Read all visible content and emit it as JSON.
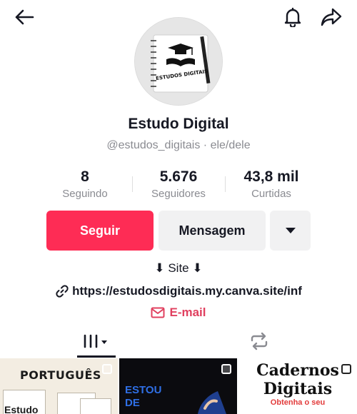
{
  "profile": {
    "display_name": "Estudo Digital",
    "handle": "@estudos_digitais · ele/dele",
    "avatar_text": "ESTUDOS DIGITAIS"
  },
  "stats": [
    {
      "value": "8",
      "label": "Seguindo"
    },
    {
      "value": "5.676",
      "label": "Seguidores"
    },
    {
      "value": "43,8 mil",
      "label": "Curtidas"
    }
  ],
  "actions": {
    "follow_label": "Seguir",
    "message_label": "Mensagem"
  },
  "bio": {
    "site_label": "⬇ Site ⬇",
    "link_text": "https://estudosdigitais.my.canva.site/inf",
    "email_label": "E-mail"
  },
  "grid": [
    {
      "title": "PORTUGUÊS",
      "subtitle": "Estudo"
    },
    {
      "title": "ESTOU DE"
    },
    {
      "title": "Cadernos Digitais",
      "subtitle": "Obtenha o seu"
    }
  ],
  "colors": {
    "accent": "#fe2c55",
    "email": "#e0405f",
    "text": "#161823",
    "muted": "#8a8b91"
  },
  "icons": {
    "back": "arrow-left-icon",
    "bell": "bell-icon",
    "share": "share-arrow-icon",
    "link": "link-icon",
    "mail": "mail-icon",
    "videos_tab": "videos-grid-icon",
    "repost_tab": "repost-icon",
    "more": "caret-down-icon"
  }
}
